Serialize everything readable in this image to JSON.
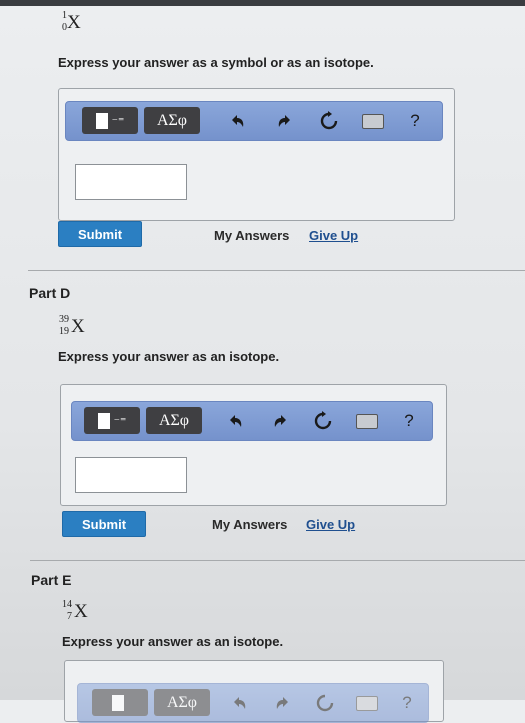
{
  "part_c": {
    "isotope": {
      "symbol": "X",
      "mass": "1",
      "atomic": "0"
    },
    "instruction": "Express your answer as a symbol or as an isotope.",
    "submit_label": "Submit",
    "my_answers_label": "My Answers",
    "give_up_label": "Give Up"
  },
  "part_d": {
    "title": "Part D",
    "isotope": {
      "symbol": "X",
      "mass": "39",
      "atomic": "19"
    },
    "instruction": "Express your answer as an isotope.",
    "submit_label": "Submit",
    "my_answers_label": "My Answers",
    "give_up_label": "Give Up"
  },
  "part_e": {
    "title": "Part E",
    "isotope": {
      "symbol": "X",
      "mass": "14",
      "atomic": "7"
    },
    "instruction": "Express your answer as an isotope."
  },
  "toolbar": {
    "greek_label": "ΑΣφ",
    "help_label": "?",
    "icons": [
      "templates-icon",
      "undo-icon",
      "redo-icon",
      "reset-icon",
      "keyboard-icon",
      "help-icon"
    ]
  },
  "colors": {
    "toolbar_blue": "#7f9cd3",
    "submit_blue": "#2b7fc2",
    "link_blue": "#1f4f8f"
  }
}
